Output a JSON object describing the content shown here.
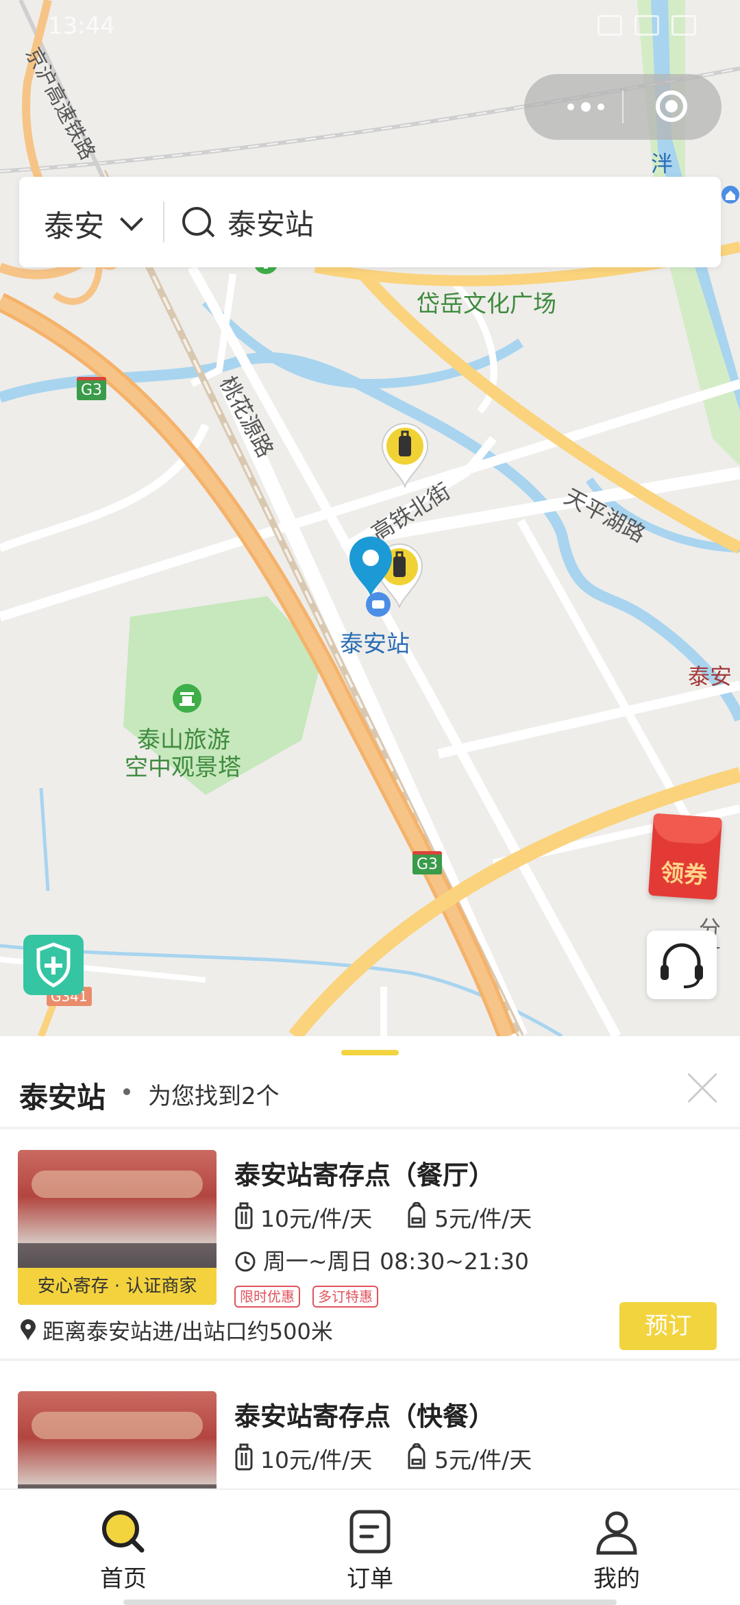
{
  "status_bar": {
    "time": "13:44"
  },
  "search": {
    "city": "泰安",
    "query": "泰安站"
  },
  "map": {
    "labels": {
      "railway": "京沪高速铁路",
      "plaza": "岱岳文化广场",
      "road_taohua": "桃花源路",
      "road_gaotie": "高铁北街",
      "road_tianping": "天平湖路",
      "station": "泰安站",
      "tower_line1": "泰山旅游",
      "tower_line2": "空中观景塔",
      "east_edge": "泰安",
      "river_edge": "泮",
      "road_g3_a": "G3",
      "road_g3_b": "G3",
      "road_g341": "G341",
      "right_edge_text": "分",
      "right_edge_text2": "丁"
    },
    "coupon_label": "领券"
  },
  "results_panel": {
    "title": "泰安站",
    "summary": "为您找到2个",
    "items": [
      {
        "name": "泰安站寄存点（餐厅）",
        "price_luggage": "10元/件/天",
        "price_bag": "5元/件/天",
        "hours": "周一~周日 08:30~21:30",
        "image_tag": "安心寄存 · 认证商家",
        "promos": [
          "限时优惠",
          "多订特惠"
        ],
        "distance": "距离泰安站进/出站口约500米",
        "book_label": "预订"
      },
      {
        "name": "泰安站寄存点（快餐）",
        "price_luggage": "10元/件/天",
        "price_bag": "5元/件/天"
      }
    ]
  },
  "tabbar": {
    "items": [
      {
        "label": "首页",
        "icon": "search-icon",
        "active": true
      },
      {
        "label": "订单",
        "icon": "order-icon",
        "active": false
      },
      {
        "label": "我的",
        "icon": "user-icon",
        "active": false
      }
    ]
  },
  "colors": {
    "accent": "#f2d43f",
    "pin_blue": "#1c9ad6",
    "promo_red": "#e0525c",
    "shield_green": "#35c5a3"
  }
}
